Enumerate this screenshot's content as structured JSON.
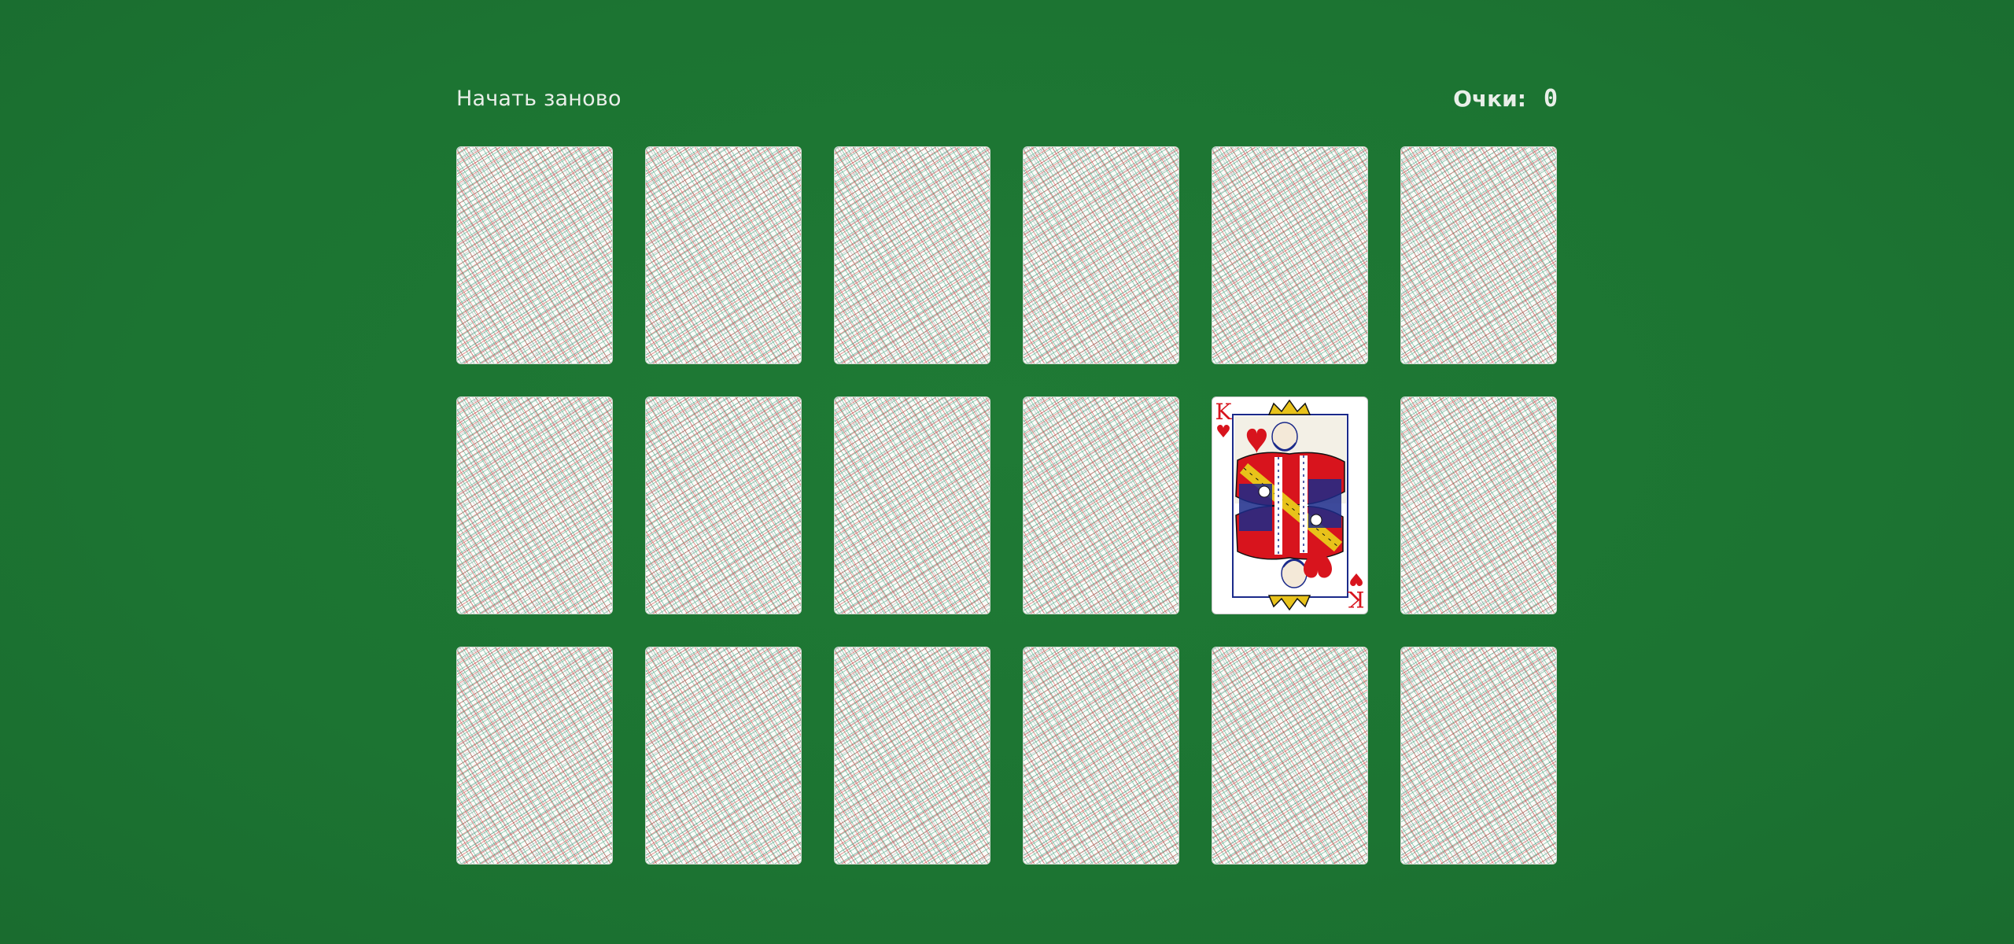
{
  "header": {
    "restart_label": "Начать заново",
    "score_label": "Очки:",
    "score_value": "0"
  },
  "cards": [
    {
      "state": "back"
    },
    {
      "state": "back"
    },
    {
      "state": "back"
    },
    {
      "state": "back"
    },
    {
      "state": "back"
    },
    {
      "state": "back"
    },
    {
      "state": "back"
    },
    {
      "state": "back"
    },
    {
      "state": "back"
    },
    {
      "state": "back"
    },
    {
      "state": "face",
      "rank": "K",
      "suit": "hearts",
      "suit_symbol": "♥"
    },
    {
      "state": "back"
    },
    {
      "state": "back"
    },
    {
      "state": "back"
    },
    {
      "state": "back"
    },
    {
      "state": "back"
    },
    {
      "state": "back"
    },
    {
      "state": "back"
    }
  ],
  "colors": {
    "table": "#1c7432",
    "text": "#e9efe9",
    "suit_red": "#d8141d",
    "crown_gold": "#e8c21a"
  }
}
